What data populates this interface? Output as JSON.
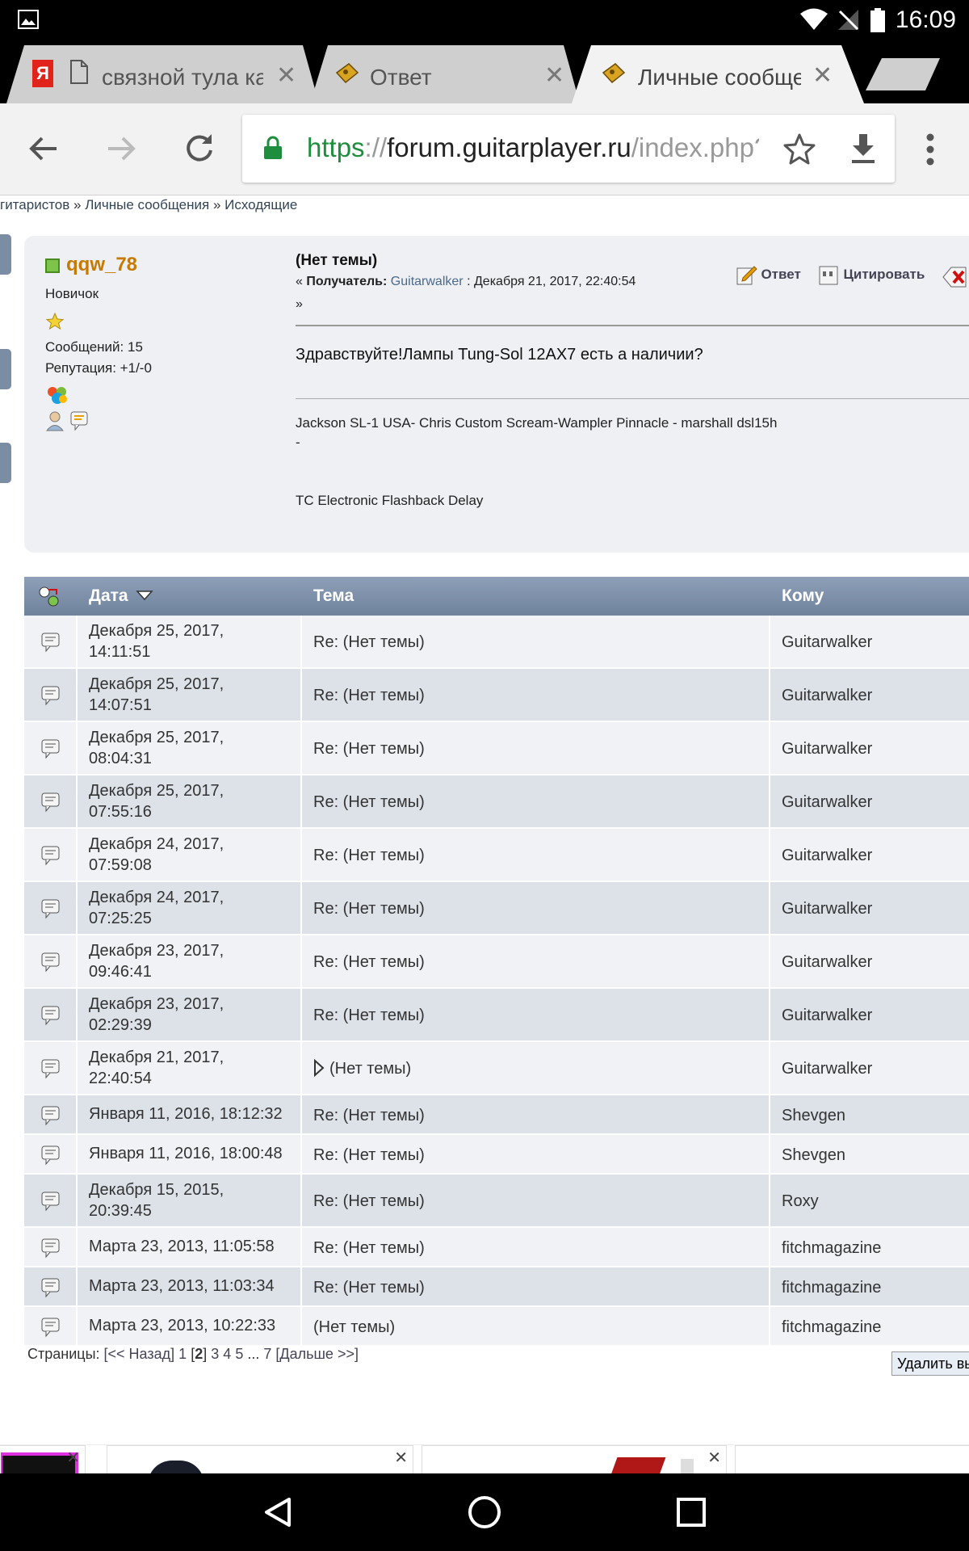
{
  "status_bar": {
    "time": "16:09"
  },
  "tabs": [
    {
      "title": "связной тула ка",
      "favicon": "document-icon"
    },
    {
      "title": "Ответ",
      "favicon": "pedal-favicon"
    },
    {
      "title": "Личные сообщения",
      "favicon": "pedal-favicon"
    }
  ],
  "address_bar": {
    "scheme": "https",
    "sep": "://",
    "host": "forum.guitarplayer.ru",
    "path": "/index.php?a"
  },
  "breadcrumb": [
    "гитаристов",
    "Личные сообщения",
    "Исходящие"
  ],
  "breadcrumb_sep": "»",
  "post": {
    "author": "qqw_78",
    "rank": "Новичок",
    "posts_label": "Сообщений: 15",
    "reputation_label": "Репутация: +1/-0",
    "subject": "(Нет темы)",
    "meta_prefix": "«",
    "recipient_label": "Получатель:",
    "recipient": "Guitarwalker",
    "date": ": Декабря 21, 2017, 22:40:54",
    "meta_suffix": "»",
    "reply_label": "Ответ",
    "quote_label": "Цитировать",
    "body": "Здравствуйте!Лампы Tung-Sol 12AX7 есть а наличии?",
    "signature_line1": "Jackson SL-1 USA- Chris Custom Scream-Wampler Pinnacle - marshall dsl15h",
    "signature_line2": "-",
    "signature_line3": "TC Electronic Flashback Delay"
  },
  "table": {
    "headers": {
      "date": "Дата",
      "subject": "Тема",
      "to": "Кому"
    },
    "rows": [
      {
        "date": [
          "Декабря 25, 2017,",
          "14:11:51"
        ],
        "subject": "Re: (Нет темы)",
        "to": "Guitarwalker"
      },
      {
        "date": [
          "Декабря 25, 2017,",
          "14:07:51"
        ],
        "subject": "Re: (Нет темы)",
        "to": "Guitarwalker"
      },
      {
        "date": [
          "Декабря 25, 2017,",
          "08:04:31"
        ],
        "subject": "Re: (Нет темы)",
        "to": "Guitarwalker"
      },
      {
        "date": [
          "Декабря 25, 2017,",
          "07:55:16"
        ],
        "subject": "Re: (Нет темы)",
        "to": "Guitarwalker"
      },
      {
        "date": [
          "Декабря 24, 2017,",
          "07:59:08"
        ],
        "subject": "Re: (Нет темы)",
        "to": "Guitarwalker"
      },
      {
        "date": [
          "Декабря 24, 2017,",
          "07:25:25"
        ],
        "subject": "Re: (Нет темы)",
        "to": "Guitarwalker"
      },
      {
        "date": [
          "Декабря 23, 2017,",
          "09:46:41"
        ],
        "subject": "Re: (Нет темы)",
        "to": "Guitarwalker"
      },
      {
        "date": [
          "Декабря 23, 2017,",
          "02:29:39"
        ],
        "subject": "Re: (Нет темы)",
        "to": "Guitarwalker"
      },
      {
        "date": [
          "Декабря 21, 2017,",
          "22:40:54"
        ],
        "subject": "(Нет темы)",
        "to": "Guitarwalker",
        "current": true
      },
      {
        "date": [
          "Января 11, 2016, 18:12:32"
        ],
        "subject": "Re: (Нет темы)",
        "to": "Shevgen"
      },
      {
        "date": [
          "Января 11, 2016, 18:00:48"
        ],
        "subject": "Re: (Нет темы)",
        "to": "Shevgen"
      },
      {
        "date": [
          "Декабря 15, 2015,",
          "20:39:45"
        ],
        "subject": "Re: (Нет темы)",
        "to": "Roxy"
      },
      {
        "date": [
          "Марта 23, 2013, 11:05:58"
        ],
        "subject": "Re: (Нет темы)",
        "to": "fitchmagazine"
      },
      {
        "date": [
          "Марта 23, 2013, 11:03:34"
        ],
        "subject": "Re: (Нет темы)",
        "to": "fitchmagazine"
      },
      {
        "date": [
          "Марта 23, 2013, 10:22:33"
        ],
        "subject": "(Нет темы)",
        "to": "fitchmagazine"
      }
    ]
  },
  "pager": {
    "label": "Страницы:",
    "prev": "[<< Назад]",
    "p1": "1",
    "current": "2",
    "p3": "3",
    "p4": "4",
    "p5": "5",
    "ellipsis": "...",
    "p7": "7",
    "next": "[Дальше >>]",
    "bracket_open": "[",
    "bracket_close": "]"
  },
  "delete_button": "Удалить вы",
  "colors": {
    "author": "#c77a00",
    "link": "#4a6a8a",
    "accent_green": "#1e8e3e"
  }
}
